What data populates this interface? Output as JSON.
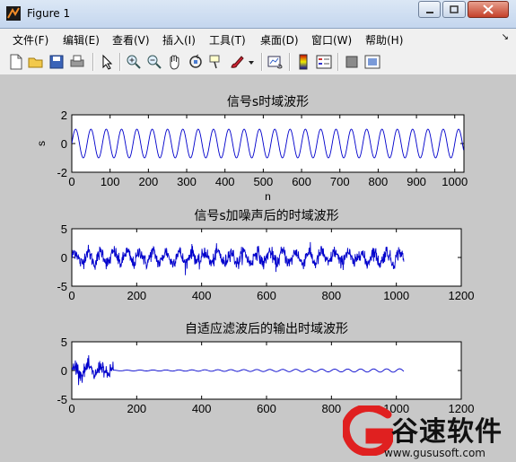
{
  "window": {
    "title": "Figure 1",
    "controls": [
      "minimize",
      "restore",
      "close"
    ]
  },
  "menubar": {
    "items": [
      "文件(F)",
      "编辑(E)",
      "查看(V)",
      "插入(I)",
      "工具(T)",
      "桌面(D)",
      "窗口(W)",
      "帮助(H)"
    ]
  },
  "toolbar": {
    "buttons": [
      "new-figure-icon",
      "open-file-icon",
      "save-figure-icon",
      "print-figure-icon",
      "edit-plot-arrow-icon",
      "zoom-in-icon",
      "zoom-out-icon",
      "pan-hand-icon",
      "rotate-3d-icon",
      "data-cursor-icon",
      "brush-icon",
      "brush-dropdown-icon",
      "link-plot-icon",
      "insert-colorbar-icon",
      "insert-legend-icon",
      "hide-plot-tools-icon",
      "show-plot-tools-icon"
    ]
  },
  "chart_data": [
    {
      "type": "line",
      "title": "信号s时域波形",
      "xlabel": "n",
      "ylabel": "s",
      "xlim": [
        0,
        1024
      ],
      "ylim": [
        -2,
        2
      ],
      "xticks": [
        0,
        100,
        200,
        300,
        400,
        500,
        600,
        700,
        800,
        900,
        1000
      ],
      "yticks": [
        -2,
        0,
        2
      ],
      "series": [
        {
          "kind": "sine",
          "n": 1024,
          "amplitude": 1,
          "period": 40,
          "color": "#0000cc"
        }
      ]
    },
    {
      "type": "line",
      "title": "信号s加噪声后的时域波形",
      "xlabel": "",
      "ylabel": "",
      "xlim": [
        0,
        1200
      ],
      "ylim": [
        -5,
        5
      ],
      "xticks": [
        0,
        200,
        400,
        600,
        800,
        1000,
        1200
      ],
      "yticks": [
        -5,
        0,
        5
      ],
      "series": [
        {
          "kind": "noisy_sine",
          "n": 1024,
          "amplitude": 1,
          "period": 40,
          "noise_std": 0.6,
          "color": "#0000cc"
        }
      ]
    },
    {
      "type": "line",
      "title": "自适应滤波后的输出时域波形",
      "xlabel": "",
      "ylabel": "",
      "xlim": [
        0,
        1200
      ],
      "ylim": [
        -5,
        5
      ],
      "xticks": [
        0,
        200,
        400,
        600,
        800,
        1000,
        1200
      ],
      "yticks": [
        -5,
        0,
        5
      ],
      "series": [
        {
          "kind": "filter_output",
          "n": 1024,
          "transient_end": 128,
          "transient_noise_std": 0.6,
          "final_amplitude": 0.25,
          "period": 40,
          "color": "#0000cc"
        }
      ]
    }
  ],
  "watermark": {
    "text": "谷速软件",
    "url": "www.gususoft.com"
  }
}
